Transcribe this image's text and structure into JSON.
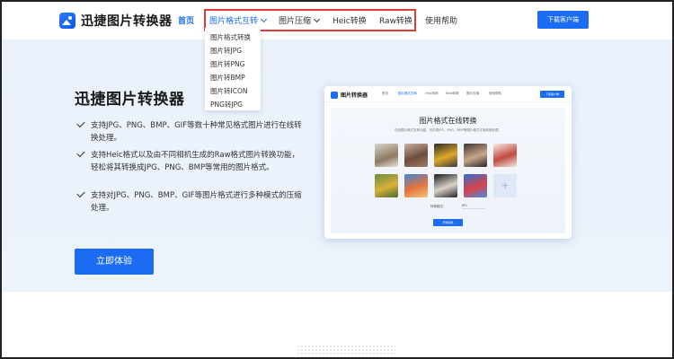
{
  "header": {
    "logo_text": "迅捷图片转换器",
    "nav": [
      "首页",
      "图片格式互转",
      "图片压缩",
      "Heic转换",
      "Raw转换",
      "使用帮助"
    ],
    "download_label": "下载客户端"
  },
  "dropdown": {
    "items": [
      "图片格式转换",
      "图片转JPG",
      "图片转PNG",
      "图片转BMP",
      "图片转ICON",
      "PNG转JPG"
    ]
  },
  "hero": {
    "title": "迅捷图片转换器",
    "features": [
      "支持JPG、PNG、BMP、GIF等数十种常见格式图片进行在线转换处理。",
      "支持Heic格式以及由不同相机生成的Raw格式图片转换功能，轻松将其转换成JPG、PNG、BMP等常用的图片格式。",
      "支持对JPG、PNG、BMP、GIF等图片格式进行多种模式的压缩处理。"
    ],
    "try_label": "立即体验"
  },
  "mock": {
    "logo_text": "图片转换器",
    "nav": [
      "首页",
      "图片格式互转",
      "Heic转换",
      "Raw转换",
      "图片压缩",
      "使用帮助"
    ],
    "download_label": "下载客户端",
    "title": "图片格式在线转换",
    "subtitle": "在线图片格式互转功能，可实现JPG、PNG、BMP等图片格式互相转换处理。",
    "format_label": "转换格式：",
    "format_value": "JPG",
    "convert_label": "开始转换",
    "add_glyph": "+"
  },
  "colors": {
    "accent": "#1b6cf2",
    "highlight_box": "#e23b3b"
  },
  "icons": [
    "logo-icon",
    "chevron-down-icon",
    "check-icon",
    "plus-icon"
  ]
}
